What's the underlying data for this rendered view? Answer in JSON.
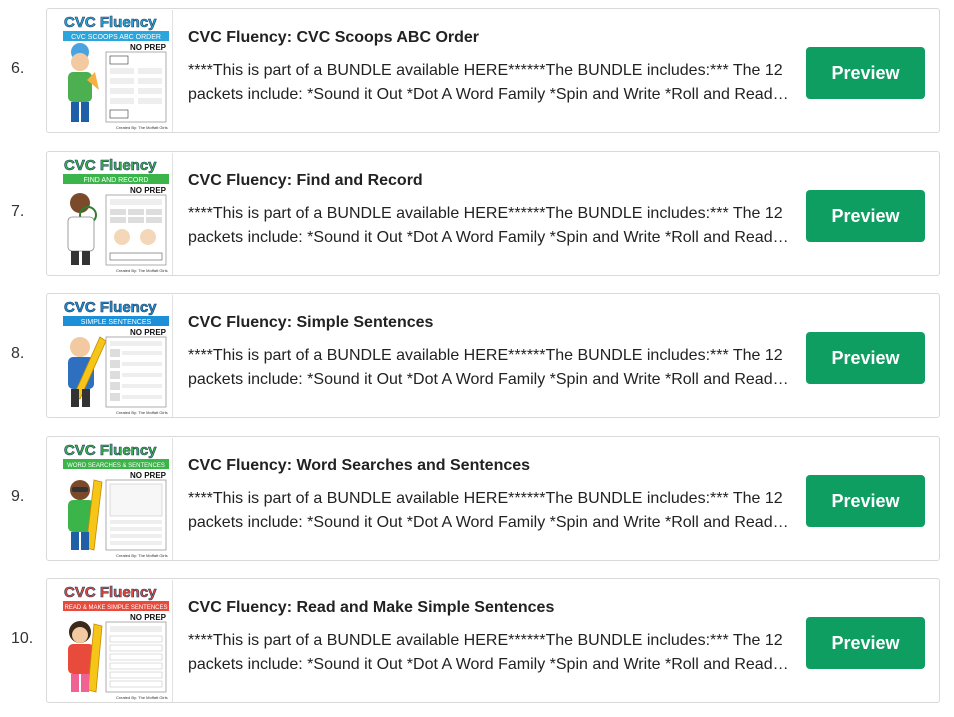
{
  "products": [
    {
      "number": "6.",
      "title": "CVC Fluency: CVC Scoops ABC Order",
      "description": "****This is part of a BUNDLE available HERE******The BUNDLE includes:*** The 12 packets include: *Sound it Out *Dot A Word Family *Spin and Write *Roll and Read *Color by Word *Cut and Paste",
      "button": "Preview",
      "thumb": {
        "brand": "CVC Fluency",
        "banner": "CVC SCOOPS ABC ORDER",
        "tag": "NO PREP",
        "credit": "Created By: The Moffatt Girls",
        "accent": "#2aa6dc"
      }
    },
    {
      "number": "7.",
      "title": "CVC Fluency: Find and Record",
      "description": "****This is part of a BUNDLE available HERE******The BUNDLE includes:*** The 12 packets include: *Sound it Out *Dot A Word Family *Spin and Write *Roll and Read *Color by Word *Cut and Paste",
      "button": "Preview",
      "thumb": {
        "brand": "CVC Fluency",
        "banner": "FIND AND RECORD",
        "tag": "NO PREP",
        "credit": "Created By: The Moffatt Girls",
        "accent": "#3bb54a"
      }
    },
    {
      "number": "8.",
      "title": "CVC Fluency: Simple Sentences",
      "description": "****This is part of a BUNDLE available HERE******The BUNDLE includes:*** The 12 packets include: *Sound it Out *Dot A Word Family *Spin and Write *Roll and Read *Color by Word *Cut and Paste",
      "button": "Preview",
      "thumb": {
        "brand": "CVC Fluency",
        "banner": "SIMPLE SENTENCES",
        "tag": "NO PREP",
        "credit": "Created By: The Moffatt Girls",
        "accent": "#1d8fd6"
      }
    },
    {
      "number": "9.",
      "title": "CVC Fluency: Word Searches and Sentences",
      "description": "****This is part of a BUNDLE available HERE******The BUNDLE includes:*** The 12 packets include: *Sound it Out *Dot A Word Family *Spin and Write *Roll and Read *Color by Word *Cut and Paste",
      "button": "Preview",
      "thumb": {
        "brand": "CVC Fluency",
        "banner": "WORD SEARCHES & SENTENCES",
        "tag": "NO PREP",
        "credit": "Created By: The Moffatt Girls",
        "accent": "#3bb54a"
      }
    },
    {
      "number": "10.",
      "title": "CVC Fluency: Read and Make Simple Sentences",
      "description": "****This is part of a BUNDLE available HERE******The BUNDLE includes:*** The 12 packets include: *Sound it Out *Dot A Word Family *Spin and Write *Roll and Read *Color by Word *Cut and Paste",
      "button": "Preview",
      "thumb": {
        "brand": "CVC Fluency",
        "banner": "READ & MAKE SIMPLE SENTENCES",
        "tag": "NO PREP",
        "credit": "Created By: The Moffatt Girls",
        "accent": "#e84a3c"
      }
    }
  ]
}
